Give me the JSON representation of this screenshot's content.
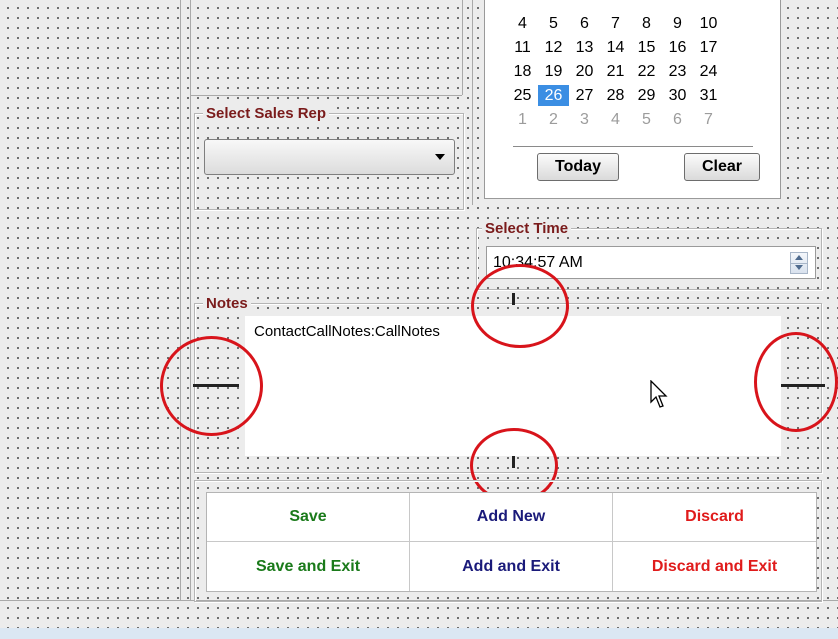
{
  "calendar": {
    "rows": [
      [
        "4",
        "5",
        "6",
        "7",
        "8",
        "9",
        "10"
      ],
      [
        "11",
        "12",
        "13",
        "14",
        "15",
        "16",
        "17"
      ],
      [
        "18",
        "19",
        "20",
        "21",
        "22",
        "23",
        "24"
      ],
      [
        "25",
        "26",
        "27",
        "28",
        "29",
        "30",
        "31"
      ]
    ],
    "next_month_row": [
      "1",
      "2",
      "3",
      "4",
      "5",
      "6",
      "7"
    ],
    "selected_day": "26",
    "today_label": "Today",
    "clear_label": "Clear"
  },
  "sales_rep": {
    "title": "Select Sales Rep",
    "value": ""
  },
  "time": {
    "title": "Select Time",
    "value": "10:34:57 AM"
  },
  "notes": {
    "title": "Notes",
    "binding": "ContactCallNotes:CallNotes"
  },
  "buttons": {
    "save": "Save",
    "add_new": "Add New",
    "discard": "Discard",
    "save_exit": "Save and Exit",
    "add_exit": "Add and Exit",
    "discard_exit": "Discard and Exit"
  },
  "colors": {
    "group_title": "#7a1b1b",
    "save": "#1a7a1a",
    "add": "#1a1a7a",
    "discard": "#e01b1b",
    "selected_day_bg": "#3b8ee3",
    "annotation_circle": "#d8141b"
  }
}
